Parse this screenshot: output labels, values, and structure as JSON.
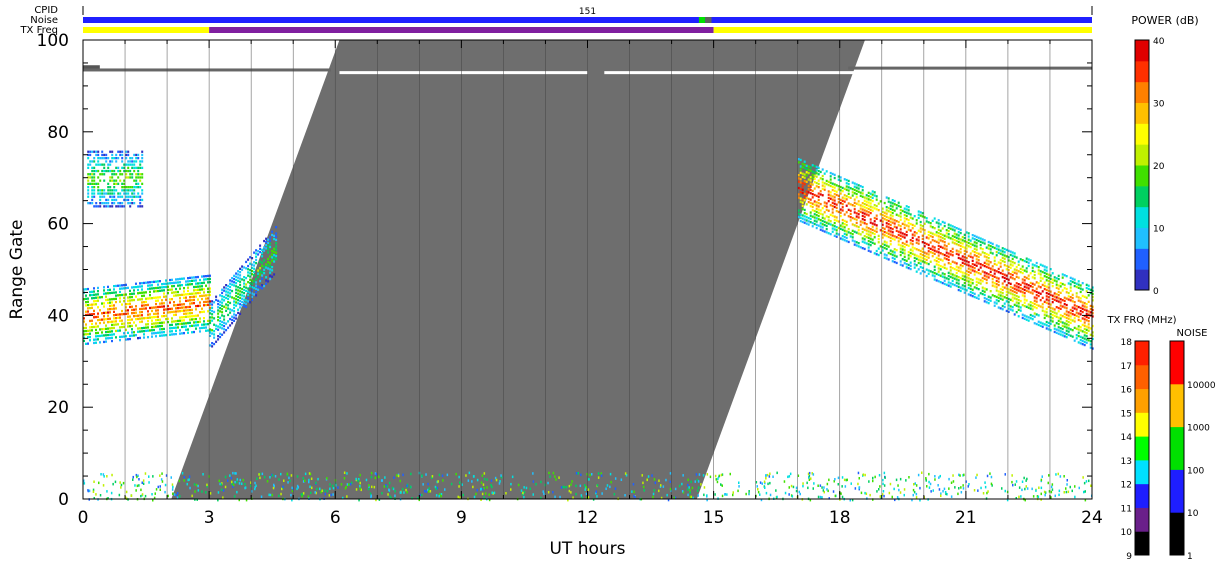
{
  "chart_data": {
    "type": "heatmap",
    "title": "",
    "xlabel": "UT hours",
    "ylabel": "Range Gate",
    "xlim": [
      0,
      24
    ],
    "ylim": [
      0,
      100
    ],
    "x_ticks": [
      0,
      3,
      6,
      9,
      12,
      15,
      18,
      21,
      24
    ],
    "y_ticks": [
      0,
      20,
      40,
      60,
      80,
      100
    ],
    "grid": "vertical lines every hour",
    "status_bars": {
      "cpid_label": "CPID",
      "cpid_value": "151",
      "noise_label": "Noise",
      "txfreq_label": "TX Freq",
      "noise_color": "#2020ff",
      "noise_segments": [
        {
          "start": 14.65,
          "end": 14.8,
          "color": "#00e000"
        },
        {
          "start": 14.8,
          "end": 14.95,
          "color": "#606060"
        }
      ],
      "txfreq_segments": [
        {
          "start": 0,
          "end": 3.0,
          "color": "#ffff00"
        },
        {
          "start": 3.0,
          "end": 15.0,
          "color": "#8020a0"
        },
        {
          "start": 15.0,
          "end": 24,
          "color": "#ffff00"
        }
      ]
    },
    "ground_scatter_band": {
      "color": "#6e6e6e",
      "bottom_start_hour": 2.1,
      "bottom_end_hour": 14.6,
      "top_start_hour": 6.1,
      "top_end_hour": 18.6,
      "gap_top_gate": 93
    },
    "regions": [
      {
        "name": "early-evening echoes",
        "x": [
          0,
          3.0
        ],
        "y_center_start": 40,
        "y_center_end": 43,
        "width": 6,
        "peak_db": 35
      },
      {
        "name": "early upper patch",
        "x": [
          0.1,
          1.4
        ],
        "y": [
          64,
          76
        ],
        "peak_db": 20
      },
      {
        "name": "diagonal streak",
        "x": [
          3.0,
          4.6
        ],
        "y_center_start": 38,
        "y_center_end": 55,
        "width": 5,
        "peak_db": 18
      },
      {
        "name": "evening echoes",
        "x": [
          17.0,
          24
        ],
        "y_center_start": 68,
        "y_center_end": 40,
        "width": 7,
        "peak_db": 38
      }
    ],
    "colorbars": [
      {
        "title": "POWER (dB)",
        "ticks": [
          0,
          10,
          20,
          30,
          40
        ],
        "colors": [
          "#3030c0",
          "#2060ff",
          "#20c0ff",
          "#00e0e0",
          "#00d060",
          "#40e000",
          "#c0f000",
          "#ffff00",
          "#ffc000",
          "#ff8000",
          "#ff3000",
          "#e00000"
        ]
      },
      {
        "title": "TX FRQ (MHz)",
        "ticks": [
          9,
          10,
          11,
          12,
          13,
          14,
          15,
          16,
          17,
          18
        ],
        "colors": [
          "#000000",
          "#6a1f8a",
          "#1e1eff",
          "#00e0ff",
          "#00ff00",
          "#ffff00",
          "#ffa000",
          "#ff6000",
          "#ff2000"
        ]
      },
      {
        "title": "NOISE",
        "ticks": [
          1,
          10,
          100,
          1000,
          10000
        ],
        "colors": [
          "#000000",
          "#1e1eff",
          "#00e000",
          "#ffc000",
          "#ff0000"
        ]
      }
    ]
  }
}
